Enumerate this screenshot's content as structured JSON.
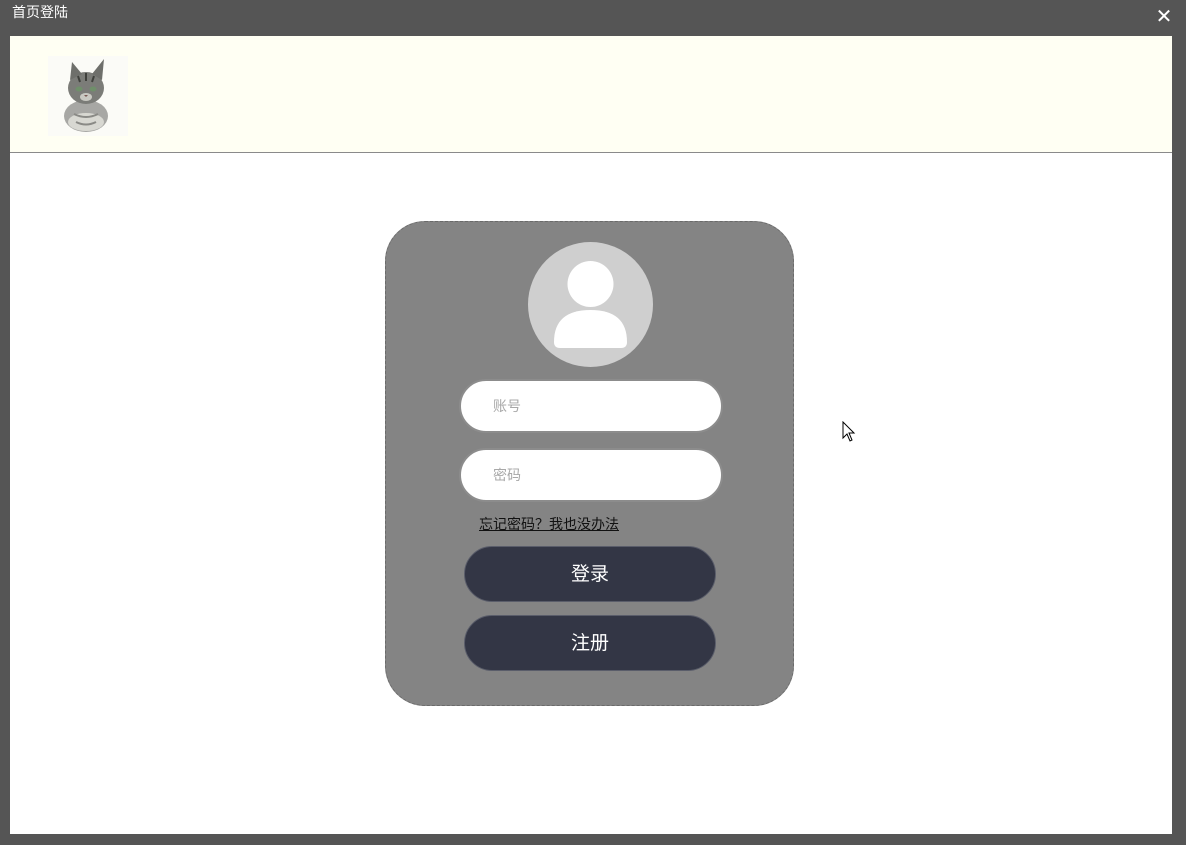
{
  "window": {
    "title": "首页登陆",
    "close_symbol": "✕"
  },
  "header": {
    "logo_icon": "cat-photo-icon"
  },
  "login": {
    "avatar_icon": "user-avatar-icon",
    "account_placeholder": "账号",
    "password_placeholder": "密码",
    "forgot_link": "忘记密码？我也没办法",
    "login_button": "登录",
    "register_button": "注册"
  },
  "colors": {
    "titlebar": "#555555",
    "header_bg": "#fffff3",
    "card_bg": "#848484",
    "button_bg": "#333645",
    "avatar_bg": "#cfcfcf"
  }
}
